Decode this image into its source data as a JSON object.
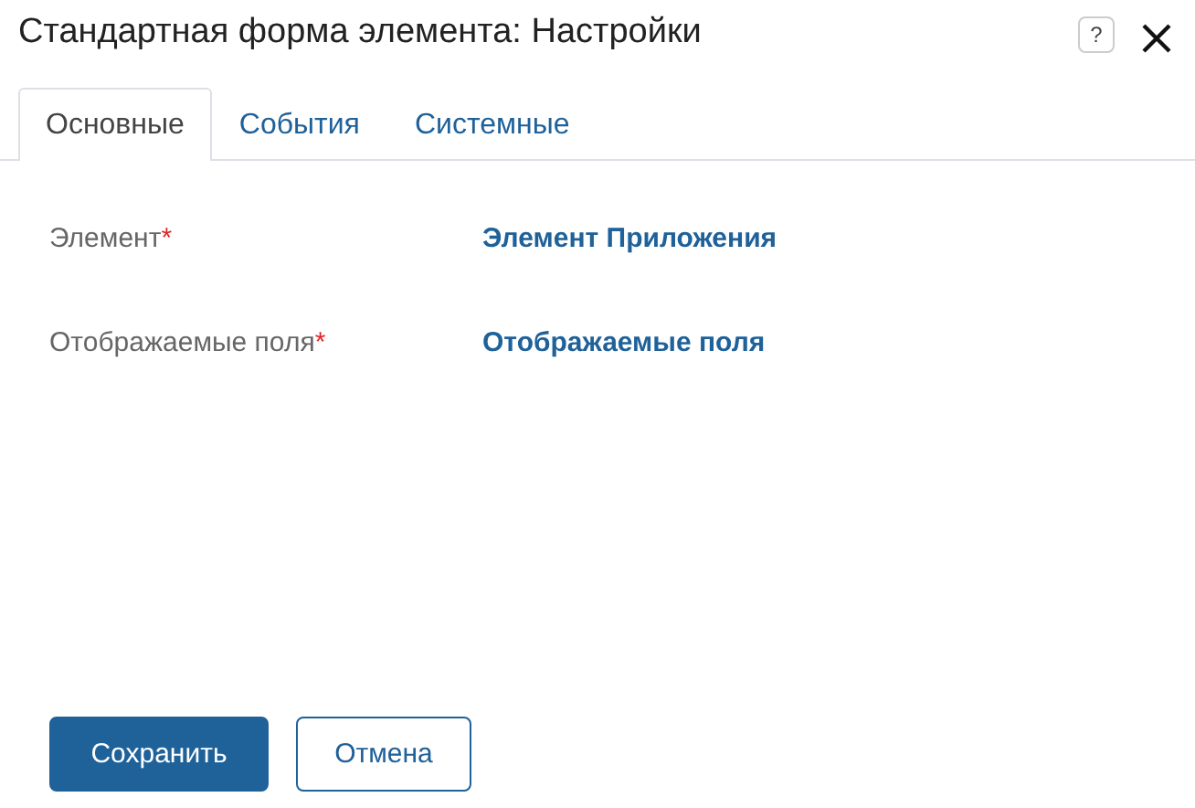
{
  "window": {
    "title": "Стандартная форма элемента: Настройки",
    "help_icon": "?"
  },
  "tabs": [
    {
      "label": "Основные",
      "selected": true
    },
    {
      "label": "События",
      "selected": false
    },
    {
      "label": "Системные",
      "selected": false
    }
  ],
  "fields": [
    {
      "label": "Элемент",
      "required_mark": "*",
      "value": "Элемент Приложения"
    },
    {
      "label": "Отображаемые поля",
      "required_mark": "*",
      "value": "Отображаемые поля"
    }
  ],
  "buttons": [
    {
      "label": "Сохранить",
      "kind": "primary"
    },
    {
      "label": "Отмена",
      "kind": "secondary"
    }
  ]
}
